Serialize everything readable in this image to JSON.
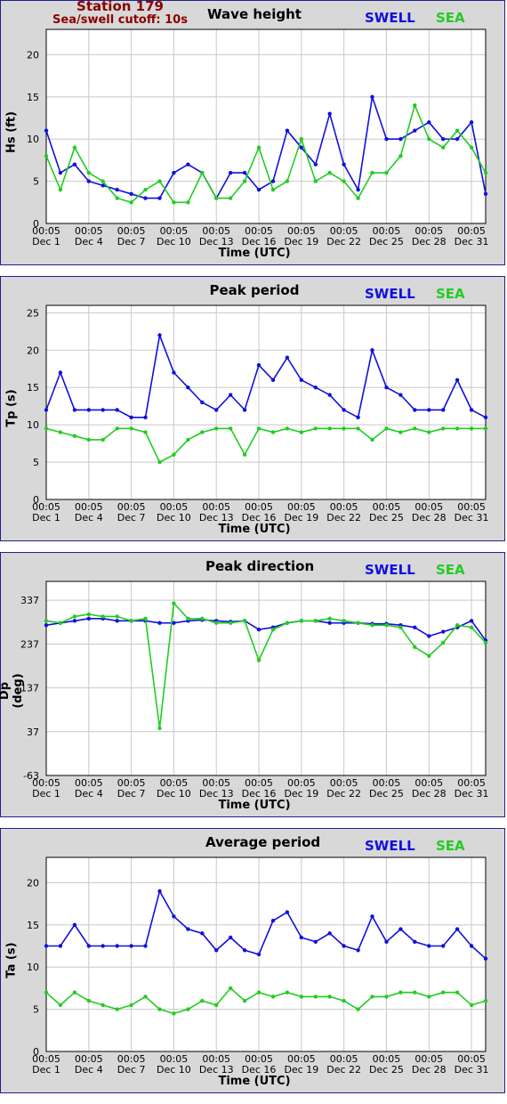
{
  "header": {
    "station": "Station 179",
    "cutoff": "Sea/swell cutoff: 10s"
  },
  "legend": {
    "swell": "SWELL",
    "sea": "SEA"
  },
  "colors": {
    "swell": "#1010dd",
    "sea": "#22cc22",
    "panel": "#d8d8d8",
    "grid": "#c8c8c8"
  },
  "x_tick_labels": [
    [
      "00:05",
      "Dec 1"
    ],
    [
      "00:05",
      "Dec 4"
    ],
    [
      "00:05",
      "Dec 7"
    ],
    [
      "00:05",
      "Dec 10"
    ],
    [
      "00:05",
      "Dec 13"
    ],
    [
      "00:05",
      "Dec 16"
    ],
    [
      "00:05",
      "Dec 19"
    ],
    [
      "00:05",
      "Dec 22"
    ],
    [
      "00:05",
      "Dec 25"
    ],
    [
      "00:05",
      "Dec 28"
    ],
    [
      "00:05",
      "Dec 31"
    ]
  ],
  "chart_data": [
    {
      "type": "line",
      "title": "Wave height",
      "xlabel": "Time (UTC)",
      "ylabel": "Hs (ft)",
      "ylim": [
        0,
        23
      ],
      "yticks": [
        0,
        5,
        10,
        15,
        20
      ],
      "xlim": [
        "2023-12-01",
        "2024-01-01"
      ],
      "grid": true,
      "series": [
        {
          "name": "SWELL",
          "x": [
            "2023-12-01",
            "2023-12-02",
            "2023-12-03",
            "2023-12-04",
            "2023-12-05",
            "2023-12-06",
            "2023-12-07",
            "2023-12-08",
            "2023-12-09",
            "2023-12-10",
            "2023-12-11",
            "2023-12-12",
            "2023-12-13",
            "2023-12-14",
            "2023-12-15",
            "2023-12-16",
            "2023-12-17",
            "2023-12-18",
            "2023-12-19",
            "2023-12-20",
            "2023-12-21",
            "2023-12-22",
            "2023-12-23",
            "2023-12-24",
            "2023-12-25",
            "2023-12-26",
            "2023-12-27",
            "2023-12-28",
            "2023-12-29",
            "2023-12-30",
            "2023-12-31",
            "2024-01-01"
          ],
          "values": [
            11,
            6,
            7,
            5,
            4.5,
            4,
            3.5,
            3,
            3,
            6,
            7,
            6,
            3,
            6,
            6,
            4,
            5,
            11,
            9,
            7,
            13,
            7,
            4,
            15,
            10,
            10,
            11,
            12,
            10,
            10,
            12,
            3.5
          ]
        },
        {
          "name": "SEA",
          "x": [
            "2023-12-01",
            "2023-12-02",
            "2023-12-03",
            "2023-12-04",
            "2023-12-05",
            "2023-12-06",
            "2023-12-07",
            "2023-12-08",
            "2023-12-09",
            "2023-12-10",
            "2023-12-11",
            "2023-12-12",
            "2023-12-13",
            "2023-12-14",
            "2023-12-15",
            "2023-12-16",
            "2023-12-17",
            "2023-12-18",
            "2023-12-19",
            "2023-12-20",
            "2023-12-21",
            "2023-12-22",
            "2023-12-23",
            "2023-12-24",
            "2023-12-25",
            "2023-12-26",
            "2023-12-27",
            "2023-12-28",
            "2023-12-29",
            "2023-12-30",
            "2023-12-31",
            "2024-01-01"
          ],
          "values": [
            8,
            4,
            9,
            6,
            5,
            3,
            2.5,
            4,
            5,
            2.5,
            2.5,
            6,
            3,
            3,
            5,
            9,
            4,
            5,
            10,
            5,
            6,
            5,
            3,
            6,
            6,
            8,
            14,
            10,
            9,
            11,
            9,
            6
          ]
        }
      ]
    },
    {
      "type": "line",
      "title": "Peak period",
      "xlabel": "Time (UTC)",
      "ylabel": "Tp (s)",
      "ylim": [
        0,
        26
      ],
      "yticks": [
        0,
        5,
        10,
        15,
        20,
        25
      ],
      "xlim": [
        "2023-12-01",
        "2024-01-01"
      ],
      "grid": true,
      "series": [
        {
          "name": "SWELL",
          "x": [
            "2023-12-01",
            "2023-12-02",
            "2023-12-03",
            "2023-12-04",
            "2023-12-05",
            "2023-12-06",
            "2023-12-07",
            "2023-12-08",
            "2023-12-09",
            "2023-12-10",
            "2023-12-11",
            "2023-12-12",
            "2023-12-13",
            "2023-12-14",
            "2023-12-15",
            "2023-12-16",
            "2023-12-17",
            "2023-12-18",
            "2023-12-19",
            "2023-12-20",
            "2023-12-21",
            "2023-12-22",
            "2023-12-23",
            "2023-12-24",
            "2023-12-25",
            "2023-12-26",
            "2023-12-27",
            "2023-12-28",
            "2023-12-29",
            "2023-12-30",
            "2023-12-31",
            "2024-01-01"
          ],
          "values": [
            12,
            17,
            12,
            12,
            12,
            12,
            11,
            11,
            22,
            17,
            15,
            13,
            12,
            14,
            12,
            18,
            16,
            19,
            16,
            15,
            14,
            12,
            11,
            20,
            15,
            14,
            12,
            12,
            12,
            16,
            12,
            11
          ]
        },
        {
          "name": "SEA",
          "x": [
            "2023-12-01",
            "2023-12-02",
            "2023-12-03",
            "2023-12-04",
            "2023-12-05",
            "2023-12-06",
            "2023-12-07",
            "2023-12-08",
            "2023-12-09",
            "2023-12-10",
            "2023-12-11",
            "2023-12-12",
            "2023-12-13",
            "2023-12-14",
            "2023-12-15",
            "2023-12-16",
            "2023-12-17",
            "2023-12-18",
            "2023-12-19",
            "2023-12-20",
            "2023-12-21",
            "2023-12-22",
            "2023-12-23",
            "2023-12-24",
            "2023-12-25",
            "2023-12-26",
            "2023-12-27",
            "2023-12-28",
            "2023-12-29",
            "2023-12-30",
            "2023-12-31",
            "2024-01-01"
          ],
          "values": [
            9.5,
            9,
            8.5,
            8,
            8,
            9.5,
            9.5,
            9,
            5,
            6,
            8,
            9,
            9.5,
            9.5,
            6,
            9.5,
            9,
            9.5,
            9,
            9.5,
            9.5,
            9.5,
            9.5,
            8,
            9.5,
            9,
            9.5,
            9,
            9.5,
            9.5,
            9.5,
            9.5
          ]
        }
      ]
    },
    {
      "type": "line",
      "title": "Peak direction",
      "xlabel": "Time (UTC)",
      "ylabel": "Dp (deg)",
      "ylim": [
        -63,
        380
      ],
      "yticks": [
        -63,
        37,
        137,
        237,
        337
      ],
      "xlim": [
        "2023-12-01",
        "2024-01-01"
      ],
      "grid": true,
      "series": [
        {
          "name": "SWELL",
          "x": [
            "2023-12-01",
            "2023-12-02",
            "2023-12-03",
            "2023-12-04",
            "2023-12-05",
            "2023-12-06",
            "2023-12-07",
            "2023-12-08",
            "2023-12-09",
            "2023-12-10",
            "2023-12-11",
            "2023-12-12",
            "2023-12-13",
            "2023-12-14",
            "2023-12-15",
            "2023-12-16",
            "2023-12-17",
            "2023-12-18",
            "2023-12-19",
            "2023-12-20",
            "2023-12-21",
            "2023-12-22",
            "2023-12-23",
            "2023-12-24",
            "2023-12-25",
            "2023-12-26",
            "2023-12-27",
            "2023-12-28",
            "2023-12-29",
            "2023-12-30",
            "2023-12-31",
            "2024-01-01"
          ],
          "values": [
            280,
            285,
            290,
            295,
            295,
            290,
            290,
            290,
            285,
            285,
            290,
            292,
            290,
            288,
            290,
            270,
            275,
            285,
            290,
            290,
            285,
            285,
            285,
            283,
            283,
            280,
            275,
            255,
            265,
            275,
            290,
            245
          ]
        },
        {
          "name": "SEA",
          "x": [
            "2023-12-01",
            "2023-12-02",
            "2023-12-03",
            "2023-12-04",
            "2023-12-05",
            "2023-12-06",
            "2023-12-07",
            "2023-12-08",
            "2023-12-09",
            "2023-12-10",
            "2023-12-11",
            "2023-12-12",
            "2023-12-13",
            "2023-12-14",
            "2023-12-15",
            "2023-12-16",
            "2023-12-17",
            "2023-12-18",
            "2023-12-19",
            "2023-12-20",
            "2023-12-21",
            "2023-12-22",
            "2023-12-23",
            "2023-12-24",
            "2023-12-25",
            "2023-12-26",
            "2023-12-27",
            "2023-12-28",
            "2023-12-29",
            "2023-12-30",
            "2023-12-31",
            "2024-01-01"
          ],
          "values": [
            290,
            285,
            300,
            305,
            300,
            300,
            290,
            295,
            45,
            330,
            295,
            295,
            285,
            285,
            290,
            200,
            270,
            285,
            290,
            290,
            295,
            290,
            285,
            280,
            280,
            275,
            230,
            210,
            240,
            280,
            275,
            240
          ]
        }
      ]
    },
    {
      "type": "line",
      "title": "Average period",
      "xlabel": "Time (UTC)",
      "ylabel": "Ta (s)",
      "ylim": [
        0,
        23
      ],
      "yticks": [
        0,
        5,
        10,
        15,
        20
      ],
      "xlim": [
        "2023-12-01",
        "2024-01-01"
      ],
      "grid": true,
      "series": [
        {
          "name": "SWELL",
          "x": [
            "2023-12-01",
            "2023-12-02",
            "2023-12-03",
            "2023-12-04",
            "2023-12-05",
            "2023-12-06",
            "2023-12-07",
            "2023-12-08",
            "2023-12-09",
            "2023-12-10",
            "2023-12-11",
            "2023-12-12",
            "2023-12-13",
            "2023-12-14",
            "2023-12-15",
            "2023-12-16",
            "2023-12-17",
            "2023-12-18",
            "2023-12-19",
            "2023-12-20",
            "2023-12-21",
            "2023-12-22",
            "2023-12-23",
            "2023-12-24",
            "2023-12-25",
            "2023-12-26",
            "2023-12-27",
            "2023-12-28",
            "2023-12-29",
            "2023-12-30",
            "2023-12-31",
            "2024-01-01"
          ],
          "values": [
            12.5,
            12.5,
            15,
            12.5,
            12.5,
            12.5,
            12.5,
            12.5,
            19,
            16,
            14.5,
            14,
            12,
            13.5,
            12,
            11.5,
            15.5,
            16.5,
            13.5,
            13,
            14,
            12.5,
            12,
            16,
            13,
            14.5,
            13,
            12.5,
            12.5,
            14.5,
            12.5,
            11
          ]
        },
        {
          "name": "SEA",
          "x": [
            "2023-12-01",
            "2023-12-02",
            "2023-12-03",
            "2023-12-04",
            "2023-12-05",
            "2023-12-06",
            "2023-12-07",
            "2023-12-08",
            "2023-12-09",
            "2023-12-10",
            "2023-12-11",
            "2023-12-12",
            "2023-12-13",
            "2023-12-14",
            "2023-12-15",
            "2023-12-16",
            "2023-12-17",
            "2023-12-18",
            "2023-12-19",
            "2023-12-20",
            "2023-12-21",
            "2023-12-22",
            "2023-12-23",
            "2023-12-24",
            "2023-12-25",
            "2023-12-26",
            "2023-12-27",
            "2023-12-28",
            "2023-12-29",
            "2023-12-30",
            "2023-12-31",
            "2024-01-01"
          ],
          "values": [
            7,
            5.5,
            7,
            6,
            5.5,
            5,
            5.5,
            6.5,
            5,
            4.5,
            5,
            6,
            5.5,
            7.5,
            6,
            7,
            6.5,
            7,
            6.5,
            6.5,
            6.5,
            6,
            5,
            6.5,
            6.5,
            7,
            7,
            6.5,
            7,
            7,
            5.5,
            6
          ]
        }
      ]
    }
  ]
}
